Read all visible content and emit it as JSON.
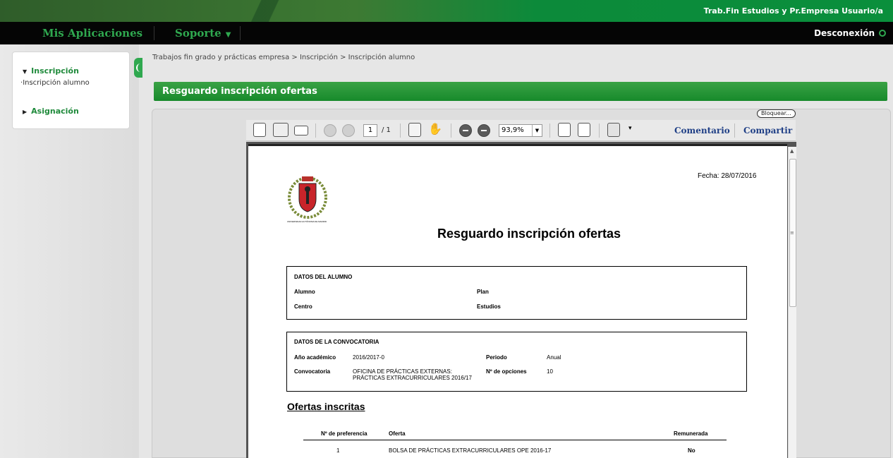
{
  "header": {
    "user_label": "Trab.Fin Estudios y Pr.Empresa Usuario/a"
  },
  "menu": {
    "apps_label": "Mis Aplicaciones",
    "support_label": "Soporte",
    "logout_label": "Desconexión"
  },
  "sidebar": {
    "sections": [
      {
        "label": "Inscripción",
        "items": [
          {
            "label": "Inscripción alumno"
          }
        ]
      },
      {
        "label": "Asignación",
        "items": []
      }
    ]
  },
  "breadcrumb": "Trabajos fin grado y prácticas empresa > Inscripción > Inscripción alumno",
  "section_title": "Resguardo inscripción ofertas",
  "viewer": {
    "lock_label": "Bloquear...",
    "page_current": "1",
    "page_total": "/ 1",
    "zoom": "93,9%",
    "comment_label": "Comentario",
    "share_label": "Compartir"
  },
  "document": {
    "date": "Fecha: 28/07/2016",
    "crest_caption": "UNIVERSIDAD AUTÓNOMA DE MADRID",
    "title": "Resguardo inscripción ofertas",
    "student_box": {
      "heading": "DATOS DEL ALUMNO",
      "alumno_label": "Alumno",
      "plan_label": "Plan",
      "centro_label": "Centro",
      "estudios_label": "Estudios"
    },
    "call_box": {
      "heading": "DATOS DE LA CONVOCATORIA",
      "year_label": "Año académico",
      "year_value": "2016/2017-0",
      "period_label": "Periodo",
      "period_value": "Anual",
      "call_label": "Convocatoria",
      "call_value_1": "OFICINA DE PRÁCTICAS EXTERNAS:",
      "call_value_2": "PRÁCTICAS EXTRACURRICULARES 2016/17",
      "options_label": "Nº de opciones",
      "options_value": "10"
    },
    "offers_title": "Ofertas inscritas",
    "offers_table": {
      "headers": [
        "Nº de preferencia",
        "Oferta",
        "Remunerada"
      ],
      "rows": [
        [
          "1",
          "BOLSA DE PRÁCTICAS EXTRACURRICULARES OPE 2016-17",
          "No"
        ]
      ]
    }
  },
  "colors": {
    "brand_green": "#178a2b",
    "menu_black": "#050505",
    "link_blue": "#1f3f86"
  }
}
